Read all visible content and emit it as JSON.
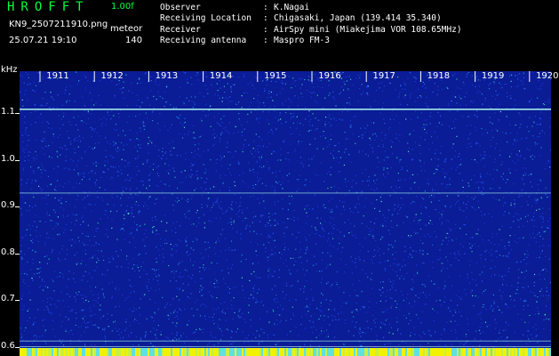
{
  "header": {
    "app_title": "HROFFT",
    "version": "1.00f",
    "filename": "KN9_2507211910.png",
    "mode": "meteor",
    "datetime": "25.07.21 19:10",
    "count": "140"
  },
  "info": [
    {
      "key": "Observer",
      "value": "K.Nagai"
    },
    {
      "key": "Receiving Location",
      "value": "Chigasaki, Japan (139.414 35.340)"
    },
    {
      "key": "Receiver",
      "value": "AirSpy mini (Miakejima VOR 108.65MHz)"
    },
    {
      "key": "Receiving antenna",
      "value": "Maspro FM-3"
    }
  ],
  "separator": ":",
  "colors": {
    "background": "#000000",
    "plot_bg": "#0a1c96",
    "carrier_line": "#b4fff0",
    "bottom_band": "#f2f200",
    "text": "#ffffff"
  },
  "chart_data": {
    "type": "heatmap",
    "ylabel": "kHz",
    "ylim": [
      0.58,
      1.19
    ],
    "yticks": [
      "1.1",
      "1.0",
      "0.9",
      "0.8",
      "0.7",
      "0.6"
    ],
    "xticks": [
      "1911",
      "1912",
      "1913",
      "1914",
      "1915",
      "1916",
      "1917",
      "1918",
      "1919",
      "1920"
    ],
    "lines_khz": [
      1.11,
      0.93,
      0.613,
      0.601
    ]
  }
}
